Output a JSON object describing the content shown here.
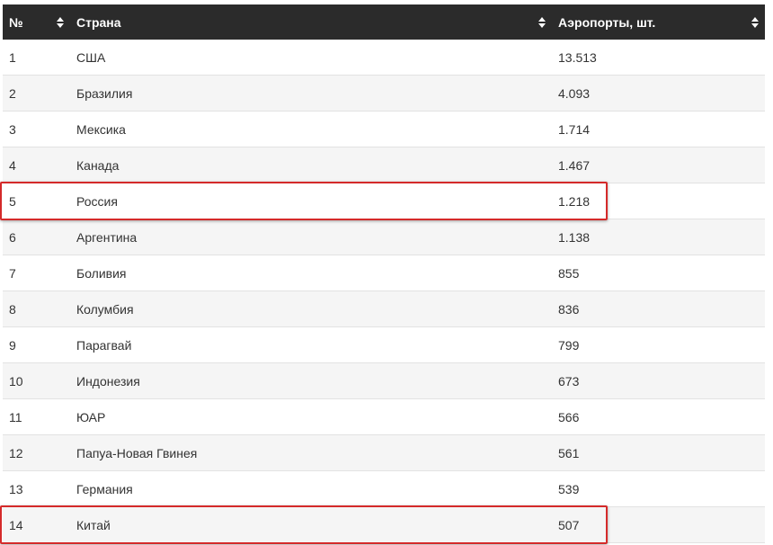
{
  "table": {
    "headers": {
      "num": "№",
      "country": "Страна",
      "airports": "Аэропорты, шт."
    },
    "rows": [
      {
        "num": "1",
        "country": "США",
        "airports": "13.513"
      },
      {
        "num": "2",
        "country": "Бразилия",
        "airports": "4.093"
      },
      {
        "num": "3",
        "country": "Мексика",
        "airports": "1.714"
      },
      {
        "num": "4",
        "country": "Канада",
        "airports": "1.467"
      },
      {
        "num": "5",
        "country": "Россия",
        "airports": "1.218"
      },
      {
        "num": "6",
        "country": "Аргентина",
        "airports": "1.138"
      },
      {
        "num": "7",
        "country": "Боливия",
        "airports": "855"
      },
      {
        "num": "8",
        "country": "Колумбия",
        "airports": "836"
      },
      {
        "num": "9",
        "country": "Парагвай",
        "airports": "799"
      },
      {
        "num": "10",
        "country": "Индонезия",
        "airports": "673"
      },
      {
        "num": "11",
        "country": "ЮАР",
        "airports": "566"
      },
      {
        "num": "12",
        "country": "Папуа-Новая Гвинея",
        "airports": "561"
      },
      {
        "num": "13",
        "country": "Германия",
        "airports": "539"
      },
      {
        "num": "14",
        "country": "Китай",
        "airports": "507"
      }
    ],
    "highlighted_rows": [
      "5",
      "14"
    ],
    "colors": {
      "header_bg": "#2b2b2b",
      "header_text": "#ffffff",
      "stripe": "#f5f5f5",
      "highlight_border": "#d42a2a"
    },
    "sort_icon": "sort-up-down-icon"
  }
}
